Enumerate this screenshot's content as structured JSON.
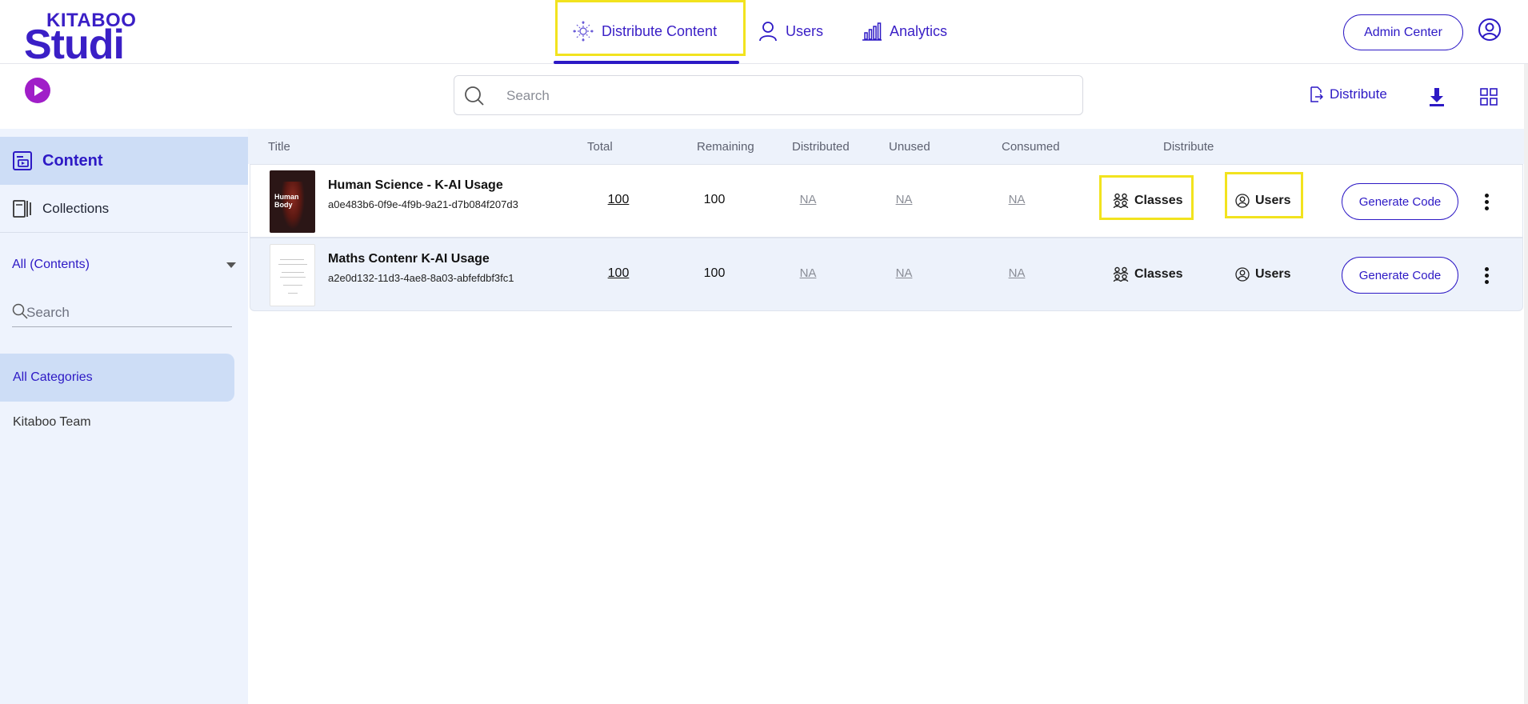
{
  "brand": {
    "top": "KITABOO",
    "bottom": "Studi"
  },
  "nav": {
    "items": [
      {
        "label": "Distribute Content",
        "icon": "distribute-network-icon",
        "active": true
      },
      {
        "label": "Users",
        "icon": "user-icon",
        "active": false
      },
      {
        "label": "Analytics",
        "icon": "bar-chart-icon",
        "active": false
      }
    ],
    "admin_label": "Admin Center"
  },
  "toolbar": {
    "search_placeholder": "Search",
    "distribute_label": "Distribute"
  },
  "sidebar": {
    "content_label": "Content",
    "collections_label": "Collections",
    "filter_label": "All (Contents)",
    "search_placeholder": "Search",
    "categories": [
      "All Categories",
      "Kitaboo Team"
    ]
  },
  "table": {
    "headers": [
      "Title",
      "Total",
      "Remaining",
      "Distributed",
      "Unused",
      "Consumed",
      "Distribute"
    ],
    "rows": [
      {
        "title": "Human Science - K-AI Usage",
        "id": "a0e483b6-0f9e-4f9b-9a21-d7b084f207d3",
        "total": "100",
        "remaining": "100",
        "distributed": "NA",
        "unused": "NA",
        "consumed": "NA",
        "classes_label": "Classes",
        "users_label": "Users",
        "generate_label": "Generate Code",
        "thumb_text": "Human Body"
      },
      {
        "title": "Maths Contenr K-AI Usage",
        "id": "a2e0d132-11d3-4ae8-8a03-abfefdbf3fc1",
        "total": "100",
        "remaining": "100",
        "distributed": "NA",
        "unused": "NA",
        "consumed": "NA",
        "classes_label": "Classes",
        "users_label": "Users",
        "generate_label": "Generate Code",
        "thumb_text": ""
      }
    ]
  },
  "colors": {
    "primary": "#2d19c5",
    "accent": "#a01ec8",
    "highlight": "#f2e31e",
    "sidebar_bg": "#eef3fd",
    "selected_bg": "#cdddf6"
  }
}
